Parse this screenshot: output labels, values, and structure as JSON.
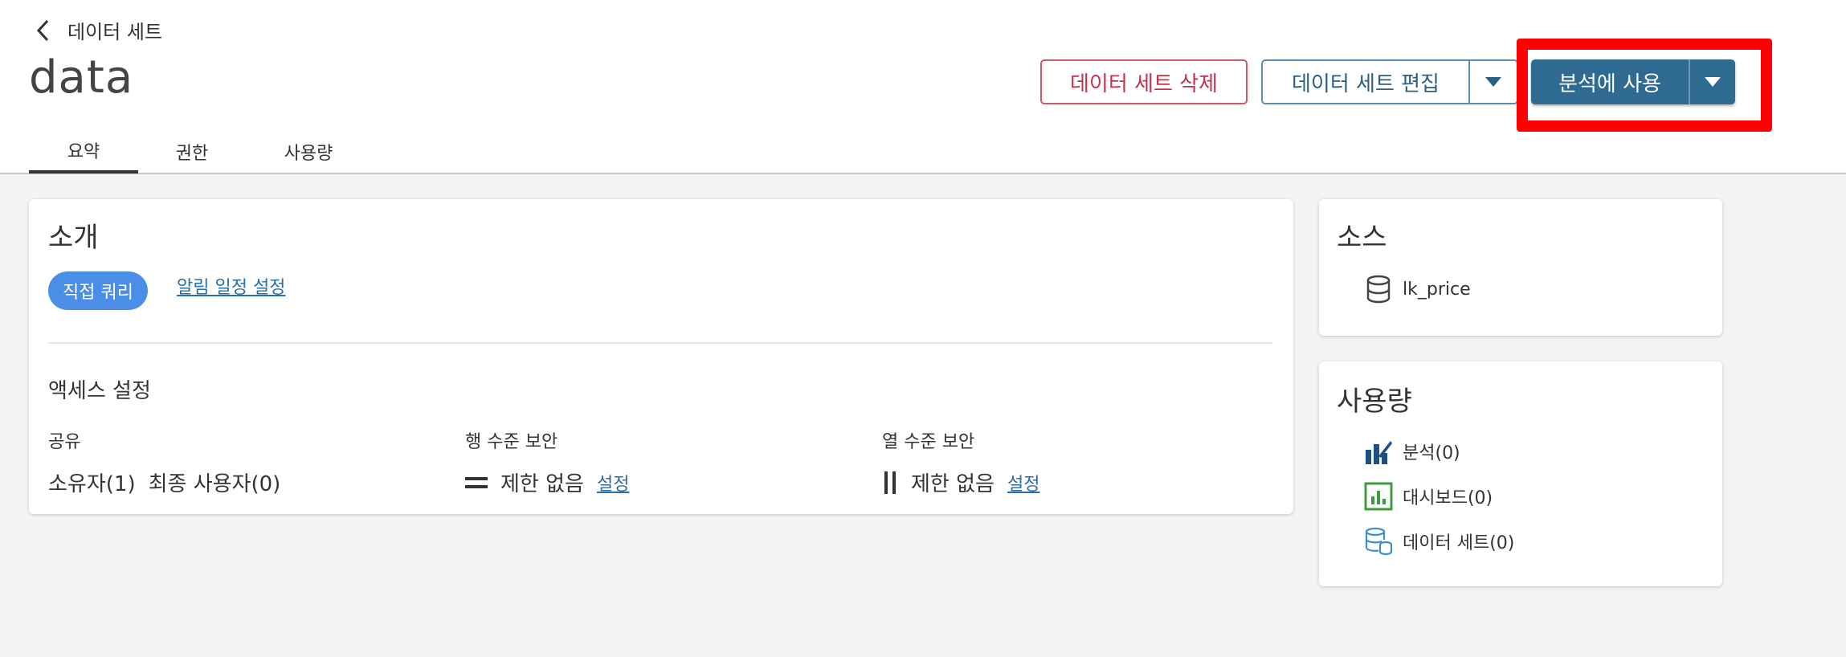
{
  "header": {
    "back_label": "데이터 세트",
    "title": "data",
    "tabs": [
      {
        "label": "요약",
        "active": true
      },
      {
        "label": "권한",
        "active": false
      },
      {
        "label": "사용량",
        "active": false
      }
    ],
    "delete_label": "데이터 세트 삭제",
    "edit_label": "데이터 세트 편집",
    "use_label": "분석에 사용"
  },
  "intro": {
    "title": "소개",
    "query_pill": "직접 쿼리",
    "alarm_link": "알림 일정 설정",
    "access_title": "액세스 설정",
    "sharing": {
      "heading": "공유",
      "owners": "소유자(1)",
      "end_users": "최종 사용자(0)"
    },
    "row_security": {
      "heading": "행 수준 보안",
      "status": "제한 없음",
      "link": "설정"
    },
    "column_security": {
      "heading": "열 수준 보안",
      "status": "제한 없음",
      "link": "설정"
    }
  },
  "source": {
    "title": "소스",
    "items": [
      {
        "icon": "database-icon",
        "label": "lk_price"
      }
    ]
  },
  "usage": {
    "title": "사용량",
    "items": [
      {
        "icon": "analysis-icon",
        "label": "분석(0)"
      },
      {
        "icon": "dashboard-icon",
        "label": "대시보드(0)"
      },
      {
        "icon": "dataset-icon",
        "label": "데이터 세트(0)"
      }
    ]
  },
  "colors": {
    "primary": "#2f6a93",
    "danger": "#c2334c",
    "pill": "#4b8ee8",
    "highlight": "#ff0000",
    "link": "#2a6ea8"
  }
}
